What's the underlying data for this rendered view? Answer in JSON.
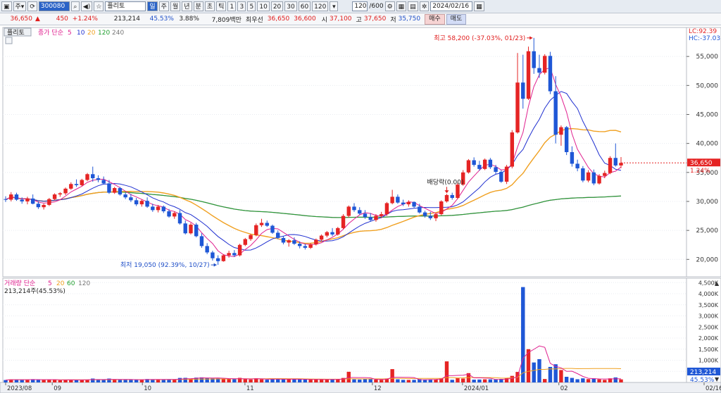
{
  "toolbar": {
    "chart_type_label": "주",
    "code_value": "300080",
    "stock_name": "플리토",
    "periods": [
      "일",
      "주",
      "월",
      "년",
      "분",
      "초",
      "틱"
    ],
    "minute_options": [
      "1",
      "3",
      "5",
      "10",
      "20",
      "30",
      "60",
      "120"
    ],
    "count_value": "120",
    "count_total": "/600",
    "date_value": "2024/02/16"
  },
  "info": {
    "price": "36,650",
    "change_arrow": "▲",
    "change": "450",
    "change_pct": "+1.24%",
    "volume": "213,214",
    "volume_pct": "45.53%",
    "turnover": "3.88%",
    "amount": "7,809백만",
    "priority_label": "최우선",
    "bid": "36,650",
    "ask": "36,600",
    "open_label": "시",
    "open": "37,100",
    "high_label": "고",
    "high": "37,650",
    "low_label": "저",
    "low": "35,750",
    "buy_label": "매수",
    "sell_label": "매도"
  },
  "price_panel": {
    "stock_label": "플리토",
    "ma_title": "종가 단순",
    "ma_periods": [
      "5",
      "10",
      "20",
      "120",
      "240"
    ],
    "lc_label": "LC:92.39",
    "hc_label": "HC:-37.03",
    "current_price_tag": "36,650",
    "current_pct_tag": "1.24%",
    "high_annotation": "최고 58,200 (-37.03%, 01/23)",
    "low_annotation": "최저 19,050 (92.39%, 10/27)",
    "dividend_annotation": "배당락(0.00)"
  },
  "volume_panel": {
    "ma_title": "거래량 단순",
    "ma_periods": [
      "5",
      "20",
      "60",
      "120"
    ],
    "current_label": "213,214주(45.53%)",
    "current_tag": "213,214",
    "current_pct_tag": "45.53%"
  },
  "colors": {
    "up": "#e52424",
    "down": "#1f57d6",
    "ma5": "#e0208f",
    "ma10": "#2030d0",
    "ma20": "#f0a020",
    "ma120": "#22a030",
    "ma240": "#777777"
  },
  "chart_data": [
    {
      "type": "candlestick",
      "title": "플리토",
      "x_tick_labels": [
        "2023/08",
        "09",
        "10",
        "11",
        "12",
        "2024/01",
        "02",
        "02/16"
      ],
      "y_ticks": [
        20000,
        25000,
        30000,
        35000,
        40000,
        45000,
        50000,
        55000
      ],
      "y_tick_labels": [
        "20,000",
        "25,000",
        "30,000",
        "35,000",
        "40,000",
        "45,000",
        "50,000",
        "55,000"
      ],
      "ylim": [
        17000,
        60000
      ],
      "candles": [
        [
          30400,
          30900,
          29900,
          30300
        ],
        [
          30300,
          31600,
          30000,
          31200
        ],
        [
          31200,
          31500,
          30100,
          30300
        ],
        [
          30300,
          30700,
          29600,
          30000
        ],
        [
          30000,
          30800,
          29500,
          30500
        ],
        [
          30500,
          31200,
          29500,
          29600
        ],
        [
          29600,
          30000,
          28700,
          29000
        ],
        [
          29000,
          29600,
          28600,
          29400
        ],
        [
          29400,
          30600,
          29200,
          30400
        ],
        [
          30400,
          31400,
          30200,
          31200
        ],
        [
          31200,
          31600,
          30800,
          31400
        ],
        [
          31400,
          32400,
          31100,
          32200
        ],
        [
          32200,
          33300,
          32000,
          33000
        ],
        [
          33000,
          33800,
          32500,
          32800
        ],
        [
          32800,
          33900,
          32600,
          33700
        ],
        [
          33700,
          34900,
          33500,
          34700
        ],
        [
          34700,
          36000,
          33400,
          34000
        ],
        [
          34000,
          34500,
          33300,
          33700
        ],
        [
          33700,
          34300,
          32900,
          33100
        ],
        [
          33100,
          33700,
          31300,
          31500
        ],
        [
          31500,
          32500,
          31300,
          32300
        ],
        [
          32300,
          32500,
          31000,
          31200
        ],
        [
          31200,
          31500,
          30400,
          30700
        ],
        [
          30700,
          31300,
          29900,
          30200
        ],
        [
          30200,
          30600,
          29200,
          29500
        ],
        [
          29500,
          30300,
          29100,
          30100
        ],
        [
          30100,
          30700,
          28900,
          29100
        ],
        [
          29100,
          29600,
          28200,
          28500
        ],
        [
          28500,
          29400,
          28100,
          29100
        ],
        [
          29100,
          29300,
          28000,
          28300
        ],
        [
          28300,
          28700,
          27200,
          27400
        ],
        [
          27400,
          28300,
          27000,
          28000
        ],
        [
          28000,
          28500,
          26000,
          26200
        ],
        [
          26200,
          26700,
          24300,
          24500
        ],
        [
          24500,
          26300,
          24300,
          26000
        ],
        [
          26000,
          26300,
          23800,
          24000
        ],
        [
          24000,
          24500,
          22000,
          22300
        ],
        [
          22300,
          22800,
          20900,
          21200
        ],
        [
          21200,
          21500,
          19800,
          20200
        ],
        [
          20200,
          20700,
          19050,
          19700
        ],
        [
          19700,
          20900,
          19600,
          20700
        ],
        [
          20700,
          21500,
          20300,
          21100
        ],
        [
          21100,
          21600,
          20400,
          20700
        ],
        [
          20700,
          22700,
          20500,
          22500
        ],
        [
          22500,
          23700,
          22300,
          23500
        ],
        [
          23500,
          24400,
          23200,
          24200
        ],
        [
          24200,
          26200,
          24000,
          25900
        ],
        [
          25900,
          27000,
          25600,
          26300
        ],
        [
          26300,
          26700,
          25600,
          25800
        ],
        [
          25800,
          26000,
          24400,
          24600
        ],
        [
          24600,
          25000,
          23500,
          23700
        ],
        [
          23700,
          24000,
          22600,
          22900
        ],
        [
          22900,
          23500,
          22200,
          23300
        ],
        [
          23300,
          23800,
          22500,
          22700
        ],
        [
          22700,
          23100,
          21900,
          22300
        ],
        [
          22300,
          22700,
          21700,
          22000
        ],
        [
          22000,
          22800,
          21800,
          22600
        ],
        [
          22600,
          23600,
          22400,
          23400
        ],
        [
          23400,
          24300,
          23100,
          24100
        ],
        [
          24100,
          24900,
          23800,
          24700
        ],
        [
          24700,
          25400,
          24000,
          24300
        ],
        [
          24300,
          25600,
          24100,
          25400
        ],
        [
          25400,
          27800,
          25200,
          27500
        ],
        [
          27500,
          29300,
          27200,
          29100
        ],
        [
          29100,
          29700,
          28200,
          28500
        ],
        [
          28500,
          29000,
          27700,
          27900
        ],
        [
          27900,
          28500,
          27000,
          27300
        ],
        [
          27300,
          28000,
          26500,
          26800
        ],
        [
          26800,
          27800,
          26500,
          27500
        ],
        [
          27500,
          28200,
          27100,
          27800
        ],
        [
          27800,
          29900,
          27500,
          29700
        ],
        [
          29700,
          32000,
          29500,
          30800
        ],
        [
          30800,
          31200,
          29600,
          29800
        ],
        [
          29800,
          30300,
          29200,
          29500
        ],
        [
          29500,
          30200,
          29100,
          29900
        ],
        [
          29900,
          30000,
          28900,
          29100
        ],
        [
          29100,
          29600,
          27900,
          28100
        ],
        [
          28100,
          28400,
          27200,
          27500
        ],
        [
          27500,
          28200,
          26800,
          27100
        ],
        [
          27100,
          28000,
          26600,
          27800
        ],
        [
          27800,
          30200,
          27600,
          30000
        ],
        [
          30000,
          31300,
          29800,
          31100
        ],
        [
          31100,
          31500,
          30300,
          30600
        ],
        [
          30600,
          33200,
          30400,
          32900
        ],
        [
          32900,
          35400,
          32700,
          35000
        ],
        [
          35000,
          37300,
          34800,
          37100
        ],
        [
          37100,
          37600,
          36000,
          36300
        ],
        [
          36300,
          37000,
          35300,
          35600
        ],
        [
          35600,
          37400,
          35400,
          37200
        ],
        [
          37200,
          37500,
          35600,
          35900
        ],
        [
          35900,
          36300,
          34700,
          35100
        ],
        [
          35100,
          35400,
          33200,
          33400
        ],
        [
          33400,
          36300,
          33000,
          36000
        ],
        [
          36000,
          42300,
          35700,
          41900
        ],
        [
          41900,
          55600,
          41700,
          50500
        ],
        [
          50500,
          55300,
          46000,
          47700
        ],
        [
          47700,
          56700,
          47500,
          55900
        ],
        [
          55900,
          58200,
          52000,
          53000
        ],
        [
          53000,
          55300,
          51300,
          52200
        ],
        [
          52200,
          55400,
          51900,
          55100
        ],
        [
          55100,
          55800,
          48500,
          49000
        ],
        [
          49000,
          51600,
          40000,
          41500
        ],
        [
          41500,
          43100,
          39600,
          42800
        ],
        [
          42800,
          43000,
          38000,
          38500
        ],
        [
          38500,
          39500,
          36000,
          36500
        ],
        [
          36500,
          37200,
          35200,
          35700
        ],
        [
          35700,
          36100,
          33300,
          33600
        ],
        [
          33600,
          35400,
          33300,
          35000
        ],
        [
          35000,
          35500,
          32800,
          33100
        ],
        [
          33100,
          34700,
          32900,
          34400
        ],
        [
          34400,
          35300,
          34000,
          34900
        ],
        [
          34900,
          37800,
          34700,
          37500
        ],
        [
          37500,
          40000,
          36000,
          36200
        ],
        [
          36200,
          37650,
          35750,
          36650
        ]
      ],
      "ma5_values": [
        29500,
        29950,
        30200,
        30300,
        30500,
        30600,
        30400,
        30300,
        30200,
        30000,
        29900,
        30100,
        30400,
        30900,
        31300,
        31800,
        32400,
        32700,
        33000,
        33200,
        33400,
        33000,
        32700,
        32300,
        31900,
        31500,
        30900,
        30400,
        30100,
        29700,
        29300,
        29000,
        28500,
        28100,
        27500,
        26800,
        26200,
        25500,
        24600,
        23700,
        22700,
        21900,
        21100,
        20600,
        20300,
        20500,
        21000,
        21800,
        22600,
        23400,
        24100,
        24800,
        25300,
        25300,
        24800,
        24200,
        23800,
        23200,
        22700,
        22300,
        22300,
        22400,
        22700,
        23100,
        23600,
        24000,
        24500,
        25100,
        25600,
        26200,
        26600,
        26500,
        26700,
        26800,
        27000,
        27500,
        28000,
        28700,
        29100,
        29500,
        29300,
        29000,
        28700,
        28400,
        28100,
        27900,
        27800,
        28200,
        28600,
        29100,
        30000,
        31000,
        32100,
        33400,
        34400,
        35200,
        35800,
        36200,
        36300,
        36400,
        36100,
        35900,
        35600,
        35600,
        35600,
        36500,
        39100,
        41700,
        44900,
        47500,
        50400,
        52700,
        53300,
        52900,
        51900,
        50400,
        47400,
        44800,
        42300,
        40000,
        38700,
        37600,
        36500,
        36100,
        35700,
        35300,
        34900,
        34600,
        34300,
        34200,
        34600,
        35100,
        35500,
        35800
      ],
      "ma10_values": [],
      "ma20_values": [],
      "ma120_values": [],
      "ma240_values": []
    },
    {
      "type": "bar",
      "title": "거래량",
      "y_ticks": [
        500000,
        1000000,
        1500000,
        2000000,
        2500000,
        3000000,
        3500000,
        4000000,
        4500000
      ],
      "y_tick_labels": [
        "500K",
        "1,000K",
        "1,500K",
        "2,000K",
        "2,500K",
        "3,000K",
        "3,500K",
        "4,000K",
        "4,500K"
      ],
      "ylim": [
        0,
        4700000
      ]
    }
  ]
}
